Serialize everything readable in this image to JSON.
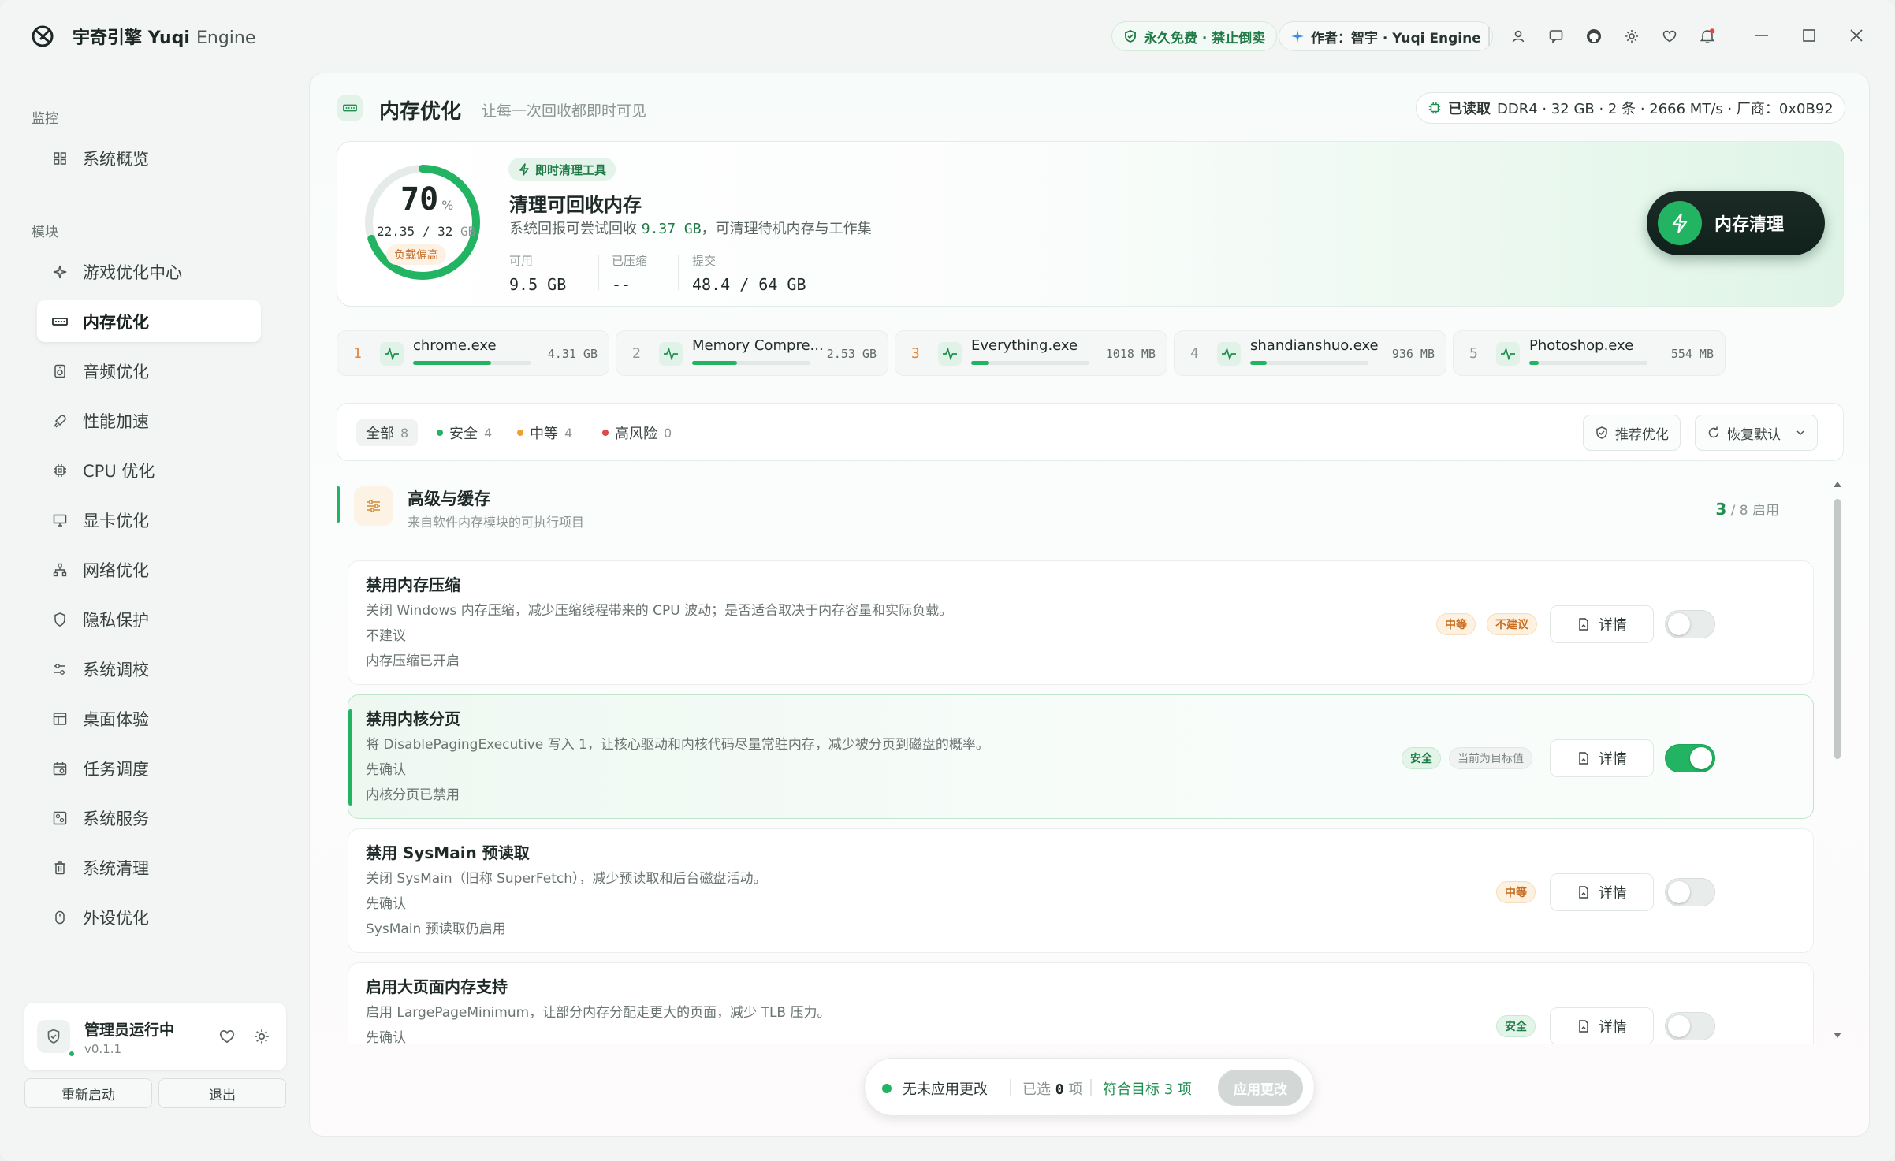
{
  "app": {
    "name": "宇奇引擎",
    "name_en": "Yuqi",
    "name_suffix": "Engine"
  },
  "titlebar": {
    "free_badge": "永久免费 · 禁止倒卖",
    "author_badge": "作者：智宇 · Yuqi Engine",
    "icons": [
      "user-icon",
      "message-icon",
      "github-icon",
      "gear-icon",
      "heart-icon",
      "bell-icon"
    ],
    "window_controls": [
      "minimize-icon",
      "maximize-icon",
      "close-icon"
    ]
  },
  "sidebar": {
    "section_monitor": "监控",
    "section_modules": "模块",
    "items": [
      {
        "label": "系统概览",
        "icon": "grid-icon"
      },
      {
        "label": "游戏优化中心",
        "icon": "sparkle-icon"
      },
      {
        "label": "内存优化",
        "icon": "memory-icon",
        "active": true
      },
      {
        "label": "音频优化",
        "icon": "speaker-icon"
      },
      {
        "label": "性能加速",
        "icon": "rocket-icon"
      },
      {
        "label": "CPU 优化",
        "icon": "cpu-icon"
      },
      {
        "label": "显卡优化",
        "icon": "monitor-icon"
      },
      {
        "label": "网络优化",
        "icon": "network-icon"
      },
      {
        "label": "隐私保护",
        "icon": "shield-icon"
      },
      {
        "label": "系统调校",
        "icon": "sliders-icon"
      },
      {
        "label": "桌面体验",
        "icon": "layout-icon"
      },
      {
        "label": "任务调度",
        "icon": "calendar-icon"
      },
      {
        "label": "系统服务",
        "icon": "service-icon"
      },
      {
        "label": "系统清理",
        "icon": "trash-icon"
      },
      {
        "label": "外设优化",
        "icon": "mouse-icon"
      }
    ],
    "admin": {
      "title": "管理员运行中",
      "version": "v0.1.1"
    },
    "restart_label": "重新启动",
    "exit_label": "退出"
  },
  "header": {
    "title": "内存优化",
    "subtitle": "让每一次回收都即时可见",
    "mem_status": "已读取",
    "mem_info": "DDR4 · 32 GB · 2 条 · 2666 MT/s · 厂商：0x0B92"
  },
  "hero": {
    "usage_percent": 70,
    "percent_sign": "%",
    "used": "22.35",
    "total": "/ 32",
    "unit": "GB",
    "warning": "负载偏高",
    "badge": "即时清理工具",
    "title": "清理可回收内存",
    "desc_prefix": "系统回报可尝试回收",
    "desc_value": "9.37 GB",
    "desc_suffix": "，可清理待机内存与工作集",
    "stats": [
      {
        "label": "可用",
        "value": "9.5 GB"
      },
      {
        "label": "已压缩",
        "value": "--"
      },
      {
        "label": "提交",
        "value": "48.4 / 64 GB"
      }
    ],
    "clean_button": "内存清理"
  },
  "processes": [
    {
      "rank": "1",
      "name": "chrome.exe",
      "size": "4.31 GB",
      "fill": 0.66
    },
    {
      "rank": "2",
      "name": "Memory Compre...",
      "size": "2.53 GB",
      "fill": 0.38
    },
    {
      "rank": "3",
      "name": "Everything.exe",
      "size": "1018 MB",
      "fill": 0.15
    },
    {
      "rank": "4",
      "name": "shandianshuo.exe",
      "size": "936 MB",
      "fill": 0.14
    },
    {
      "rank": "5",
      "name": "Photoshop.exe",
      "size": "554 MB",
      "fill": 0.08
    }
  ],
  "filters": {
    "all": {
      "label": "全部",
      "count": "8"
    },
    "safe": {
      "label": "安全",
      "count": "4"
    },
    "medium": {
      "label": "中等",
      "count": "4"
    },
    "high": {
      "label": "高风险",
      "count": "0"
    },
    "recommend_label": "推荐优化",
    "restore_label": "恢复默认"
  },
  "group": {
    "title": "高级与缓存",
    "subtitle": "来自软件内存模块的可执行项目",
    "enabled": "3",
    "total": "/ 8 启用"
  },
  "options": [
    {
      "title": "禁用内存压缩",
      "desc": "关闭 Windows 内存压缩，减少压缩线程带来的 CPU 波动；是否适合取决于内存容量和实际负载。",
      "recommend": "不建议",
      "status": "内存压缩已开启",
      "tags": [
        "中等",
        "不建议"
      ],
      "detail": "详情",
      "enabled": false
    },
    {
      "title": "禁用内核分页",
      "desc": "将 DisablePagingExecutive 写入 1，让核心驱动和内核代码尽量常驻内存，减少被分页到磁盘的概率。",
      "recommend": "先确认",
      "status": "内核分页已禁用",
      "tags": [
        "安全",
        "当前为目标值"
      ],
      "detail": "详情",
      "enabled": true
    },
    {
      "title": "禁用 SysMain 预读取",
      "desc": "关闭 SysMain（旧称 SuperFetch），减少预读取和后台磁盘活动。",
      "recommend": "先确认",
      "status": "SysMain 预读取仍启用",
      "tags": [
        "中等"
      ],
      "detail": "详情",
      "enabled": false
    },
    {
      "title": "启用大页面内存支持",
      "desc": "启用 LargePageMinimum，让部分内存分配走更大的页面，减少 TLB 压力。",
      "recommend": "先确认",
      "status": "",
      "tags": [
        "安全"
      ],
      "detail": "详情",
      "enabled": false
    }
  ],
  "statusbar": {
    "state": "无未应用更改",
    "selected_prefix": "已选",
    "selected_count": "0",
    "selected_suffix": "项",
    "target": "符合目标 3 项",
    "apply": "应用更改"
  },
  "colors": {
    "accent": "#22b462",
    "warn": "#c86d1e",
    "danger": "#e04848",
    "dark_button": "#142820"
  }
}
